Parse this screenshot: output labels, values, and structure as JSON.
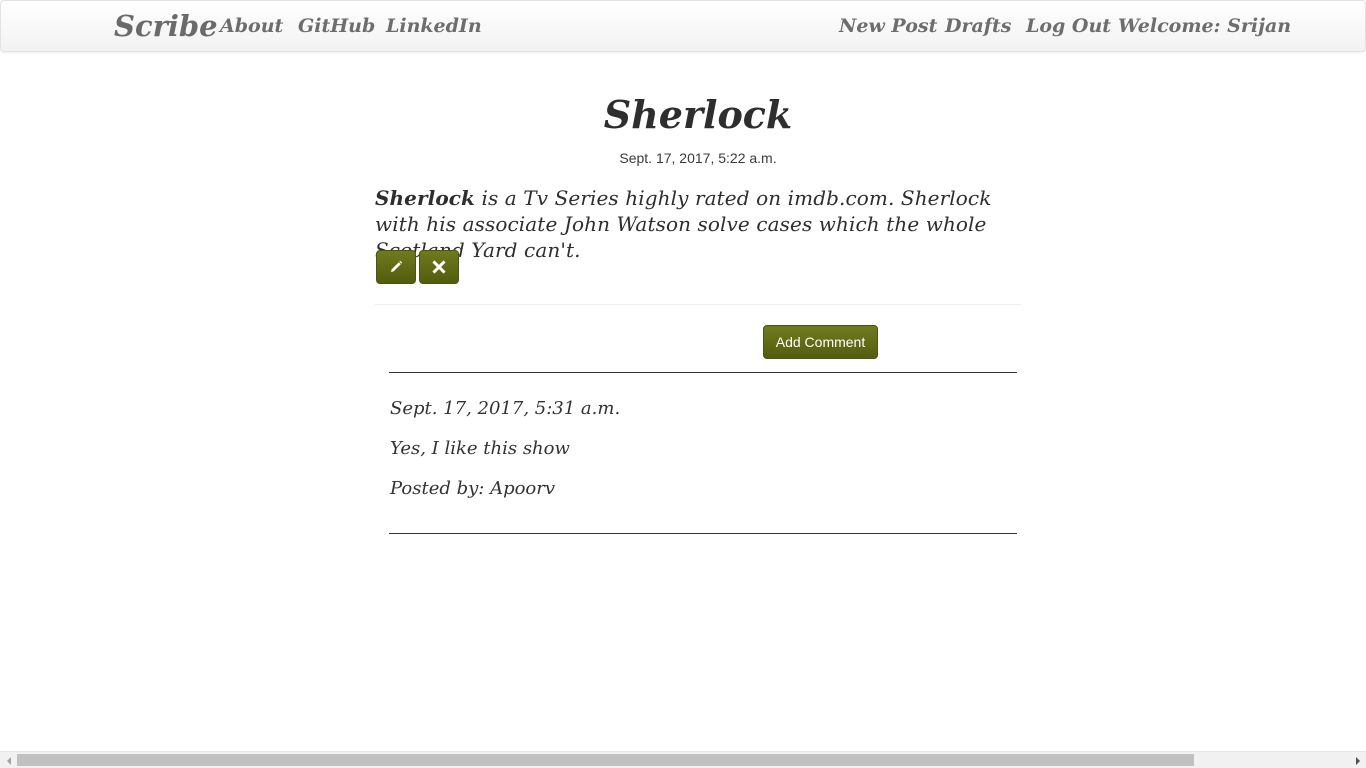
{
  "navbar": {
    "brand": "Scribe",
    "left_links": [
      "About",
      "GitHub",
      "LinkedIn"
    ],
    "right_links": [
      "New Post",
      "Drafts",
      "Log Out",
      "Welcome: Srijan"
    ]
  },
  "post": {
    "title": "Sherlock",
    "date": "Sept. 17, 2017, 5:22 a.m.",
    "body_bold": "Sherlock",
    "body_rest": " is a Tv Series highly rated on imdb.com. Sherlock with his associate John Watson solve cases which the whole Scotland Yard can't.",
    "edit_icon": "pencil-icon",
    "delete_icon": "close-icon"
  },
  "comments_section": {
    "add_comment_label": "Add Comment",
    "separator": "__________________________________________________________________",
    "comments": [
      {
        "date": "Sept. 17, 2017, 5:31 a.m.",
        "text": "Yes, I like this show",
        "posted_by": "Posted by: Apoorv"
      }
    ]
  },
  "colors": {
    "button_green": "#5f6a16",
    "nav_text": "#6d6d6d",
    "text_dark": "#2e2e2e"
  }
}
